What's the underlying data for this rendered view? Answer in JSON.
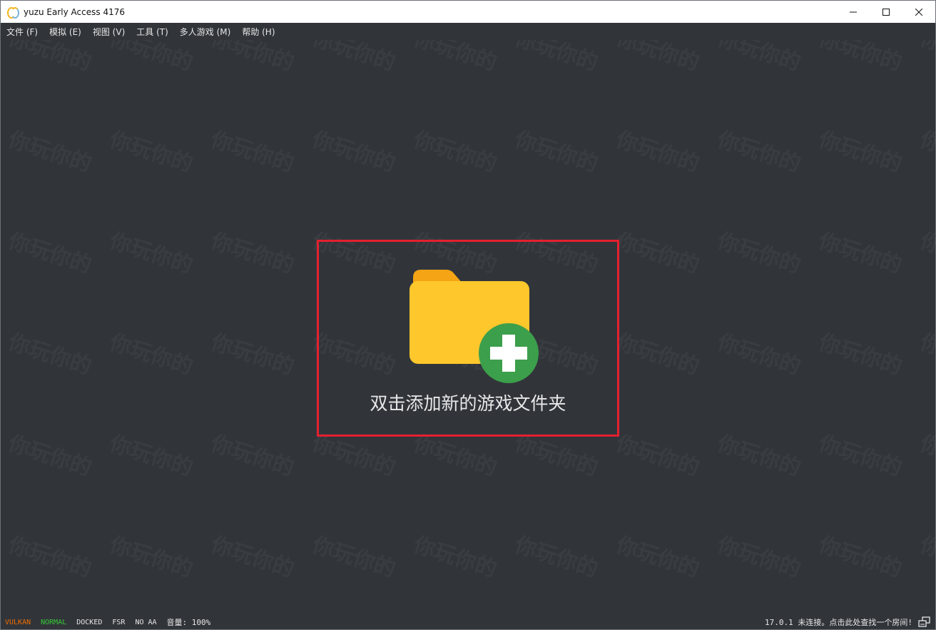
{
  "window": {
    "title": "yuzu Early Access 4176"
  },
  "menu": [
    {
      "label": "文件 (F)"
    },
    {
      "label": "模拟 (E)"
    },
    {
      "label": "视图 (V)"
    },
    {
      "label": "工具 (T)"
    },
    {
      "label": "多人游戏 (M)"
    },
    {
      "label": "帮助 (H)"
    }
  ],
  "watermark_text": "你玩你的",
  "main": {
    "add_folder_label": "双击添加新的游戏文件夹"
  },
  "status": {
    "api": {
      "label": "VULKAN",
      "color": "#f06b00"
    },
    "mode": {
      "label": "NORMAL",
      "color": "#38c838"
    },
    "dock": {
      "label": "DOCKED",
      "color": "#e6e6e6"
    },
    "filter": {
      "label": "FSR",
      "color": "#e6e6e6"
    },
    "aa": {
      "label": "NO AA",
      "color": "#e6e6e6"
    },
    "volume": {
      "label": "音量: 100%",
      "color": "#e6e6e6"
    },
    "room": "17.0.1 未连接。点击此处查找一个房间!"
  },
  "icons": {
    "folder": "folder-plus-icon",
    "network": "network-disconnected-icon"
  }
}
